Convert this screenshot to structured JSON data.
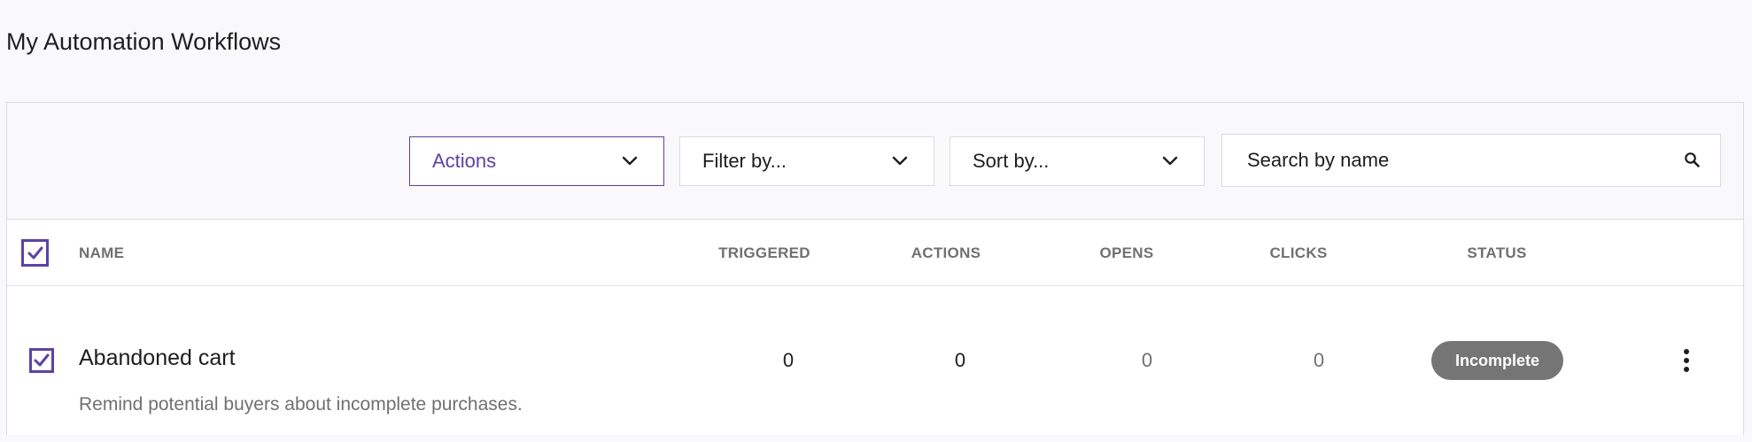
{
  "page": {
    "title": "My Automation Workflows"
  },
  "toolbar": {
    "actions_label": "Actions",
    "filter_label": "Filter by...",
    "sort_label": "Sort by...",
    "search_placeholder": "Search by name"
  },
  "table": {
    "columns": {
      "name": "NAME",
      "triggered": "TRIGGERED",
      "actions": "ACTIONS",
      "opens": "OPENS",
      "clicks": "CLICKS",
      "status": "STATUS"
    },
    "select_all_checked": true,
    "rows": [
      {
        "name": "Abandoned cart",
        "description": "Remind potential buyers about incomplete purchases.",
        "triggered": "0",
        "actions": "0",
        "opens": "0",
        "clicks": "0",
        "status": "Incomplete",
        "checked": true
      }
    ]
  },
  "colors": {
    "accent": "#5b3fb5",
    "status_badge": "#757575",
    "muted_text": "#707070"
  },
  "icons": {
    "dropdown": "chevron-down-icon",
    "search": "search-icon",
    "checkbox": "checkmark-icon",
    "row_menu": "more-vertical-icon"
  }
}
